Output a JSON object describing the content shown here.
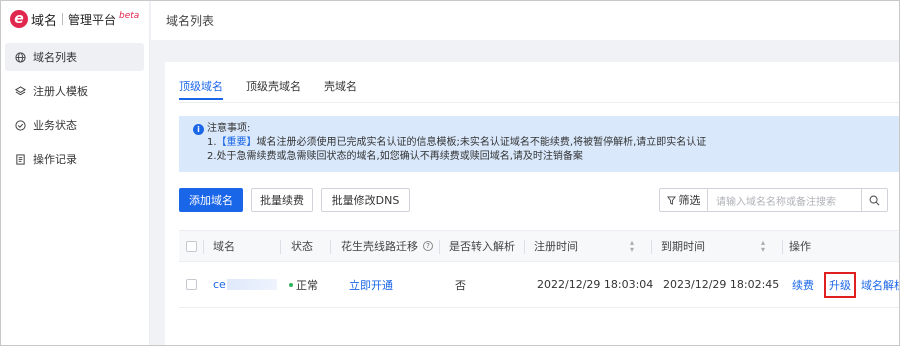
{
  "brand": {
    "logo_letter": "e",
    "name": "域名",
    "subtitle": "管理平台",
    "badge": "beta",
    "brand_color": "#e0284f"
  },
  "sidebar": {
    "items": [
      {
        "label": "域名列表",
        "icon": "globe-icon",
        "active": true
      },
      {
        "label": "注册人模板",
        "icon": "layers-icon",
        "active": false
      },
      {
        "label": "业务状态",
        "icon": "check-circle-icon",
        "active": false
      },
      {
        "label": "操作记录",
        "icon": "document-icon",
        "active": false
      }
    ]
  },
  "header": {
    "title": "域名列表"
  },
  "tabs": [
    {
      "label": "顶级域名",
      "active": true
    },
    {
      "label": "顶级壳域名",
      "active": false
    },
    {
      "label": "壳域名",
      "active": false
    }
  ],
  "notice": {
    "title": "注意事项:",
    "line1_prefix": "1.",
    "line1_emphasis": "【重要】",
    "line1_text": "域名注册必须使用已完成实名认证的信息模板;未实名认证域名不能续费,将被暂停解析,请立即实名认证",
    "line2": "2.处于急需续费或急需赎回状态的域名,如您确认不再续费或赎回域名,请及时注销备案"
  },
  "toolbar": {
    "add_label": "添加域名",
    "renew_label": "批量续费",
    "dns_label": "批量修改DNS",
    "filter_label": "筛选",
    "search_placeholder": "请输入域名名称或备注搜索"
  },
  "table": {
    "headers": {
      "domain": "域名",
      "status": "状态",
      "route": "花生壳线路迁移",
      "transfer": "是否转入解析",
      "reg_time": "注册时间",
      "exp_time": "到期时间",
      "actions": "操作"
    },
    "rows": [
      {
        "domain_prefix": "ce",
        "status": "正常",
        "route_action": "立即开通",
        "transfer": "否",
        "reg_time": "2022/12/29 18:03:04",
        "exp_time": "2023/12/29 18:02:45",
        "action_renew": "续费",
        "action_upgrade": "升级",
        "action_dns": "域名解析"
      }
    ]
  },
  "colors": {
    "accent": "#1a66e8",
    "status_ok": "#2db35d",
    "highlight_box": "#e02020"
  }
}
